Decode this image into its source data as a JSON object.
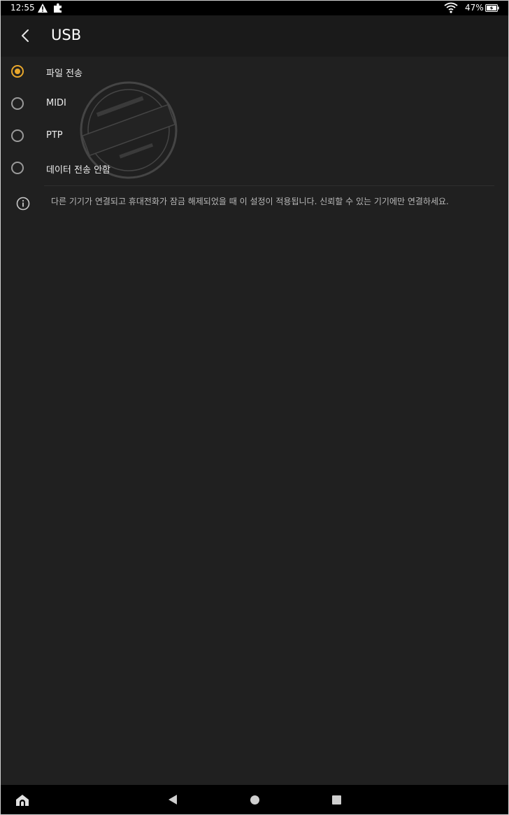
{
  "status_bar": {
    "time": "12:55",
    "battery_percent": "47%",
    "icons": [
      "warning-icon",
      "puzzle-icon",
      "wifi-icon",
      "battery-charging-icon"
    ]
  },
  "app_bar": {
    "title": "USB",
    "back_icon": "back-arrow-icon"
  },
  "options": [
    {
      "label": "파일 전송",
      "selected": true
    },
    {
      "label": "MIDI",
      "selected": false
    },
    {
      "label": "PTP",
      "selected": false
    },
    {
      "label": "데이터 전송 안함",
      "selected": false
    }
  ],
  "info": {
    "icon": "info-icon",
    "text": "다른 기기가 연결되고 휴대전화가 잠금 해제되었을 때 이 설정이 적용됩니다. 신뢰할 수 있는 기기에만 연결하세요."
  },
  "nav_bar": {
    "icons": [
      "home-app-icon",
      "back-icon",
      "home-icon",
      "recents-icon"
    ]
  },
  "colors": {
    "accent": "#e8a72c",
    "background": "#202020",
    "app_bar": "#1a1a1a"
  }
}
